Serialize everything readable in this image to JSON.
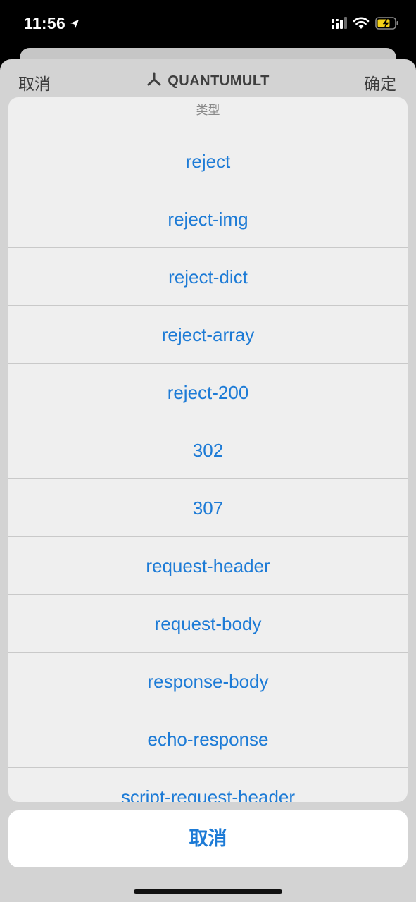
{
  "status_bar": {
    "time": "11:56"
  },
  "nav": {
    "cancel_label": "取消",
    "title": "QUANTUMULT",
    "confirm_label": "确定"
  },
  "action_sheet": {
    "header": "类型",
    "items": [
      {
        "label": "reject"
      },
      {
        "label": "reject-img"
      },
      {
        "label": "reject-dict"
      },
      {
        "label": "reject-array"
      },
      {
        "label": "reject-200"
      },
      {
        "label": "302"
      },
      {
        "label": "307"
      },
      {
        "label": "request-header"
      },
      {
        "label": "request-body"
      },
      {
        "label": "response-body"
      },
      {
        "label": "echo-response"
      },
      {
        "label": "script-request-header"
      }
    ],
    "cancel_label": "取消"
  },
  "colors": {
    "accent": "#1d7bd6",
    "battery": "#f5d21a"
  }
}
